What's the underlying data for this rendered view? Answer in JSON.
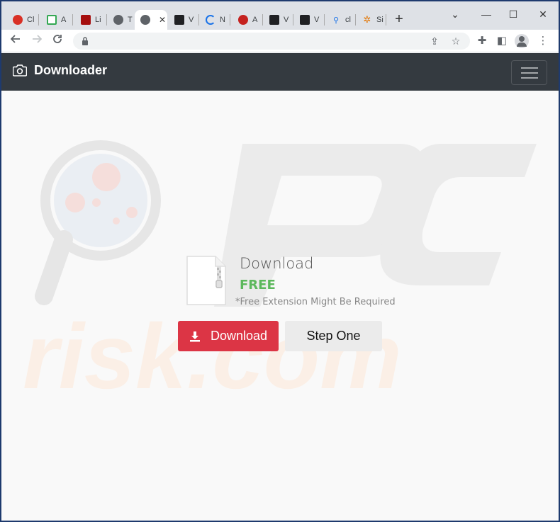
{
  "browser": {
    "tabs": [
      {
        "title": "Cl",
        "color": "#d93025",
        "active": false
      },
      {
        "title": "A",
        "color": "#34a853",
        "active": false
      },
      {
        "title": "Li",
        "color": "#a50e0e",
        "active": false
      },
      {
        "title": "T",
        "color": "#5f6368",
        "active": false
      },
      {
        "title": "",
        "color": "#5f6368",
        "active": true
      },
      {
        "title": "V",
        "color": "#202124",
        "active": false
      },
      {
        "title": "N",
        "color": "#1a73e8",
        "active": false
      },
      {
        "title": "A",
        "color": "#c5221f",
        "active": false
      },
      {
        "title": "V",
        "color": "#202124",
        "active": false
      },
      {
        "title": "V",
        "color": "#202124",
        "active": false
      },
      {
        "title": "cl",
        "color": "#1a73e8",
        "active": false
      },
      {
        "title": "Si",
        "color": "#e37400",
        "active": false
      }
    ],
    "new_tab_symbol": "+",
    "window_controls": {
      "minimize": "⌄",
      "restore": "—",
      "maximize": "☐",
      "close": "✕"
    },
    "url": ""
  },
  "site": {
    "brand": "Downloader",
    "watermark": "risk.com"
  },
  "download": {
    "title": "Download",
    "price": "FREE",
    "note": "*Free Extension Might Be Required",
    "download_button": "Download",
    "step_button": "Step One"
  },
  "colors": {
    "navbar": "#343a40",
    "download_button": "#dc3545",
    "free_text": "#5cb85c"
  }
}
